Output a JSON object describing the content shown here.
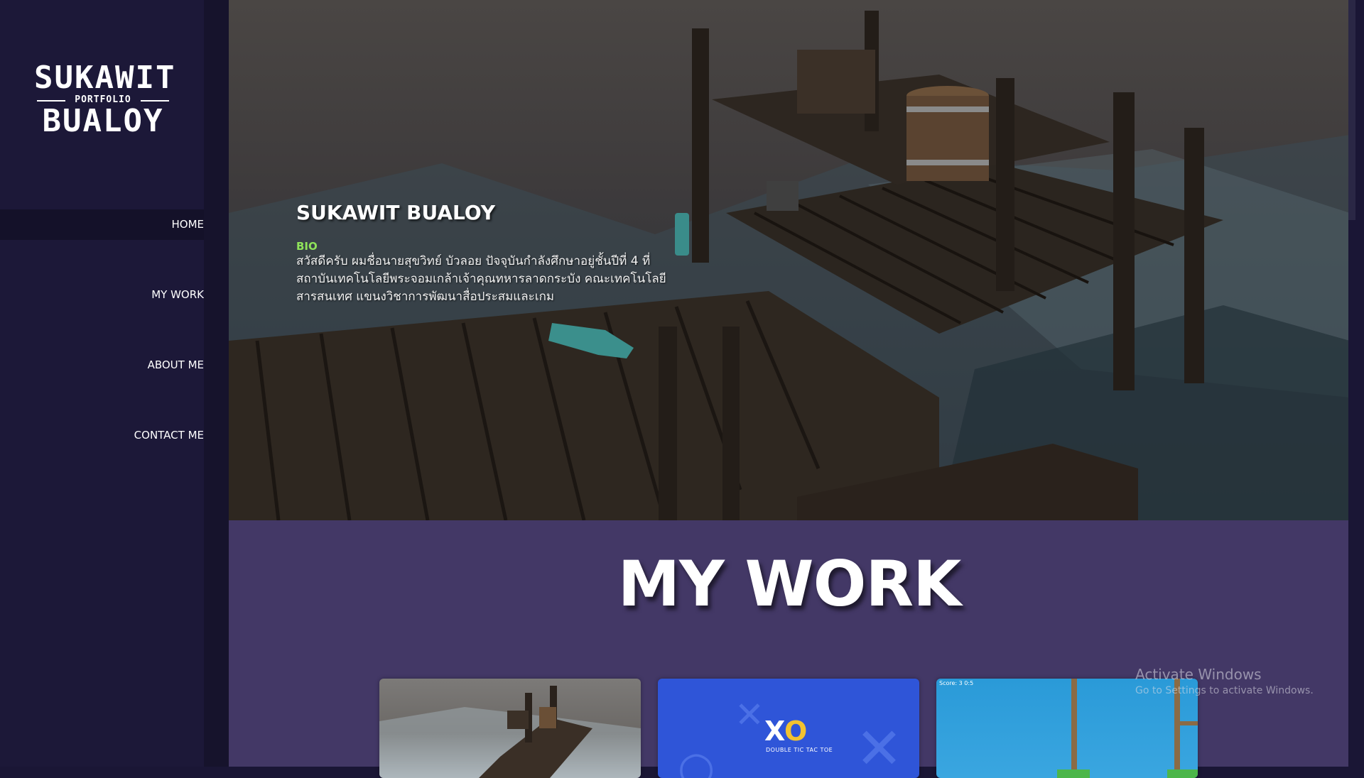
{
  "sidebar": {
    "logo": {
      "top": "SUKAWIT",
      "middle": "PORTFOLIO",
      "bottom": "BUALOY"
    },
    "nav": [
      {
        "label": "HOME",
        "active": true
      },
      {
        "label": "MY WORK",
        "active": false
      },
      {
        "label": "ABOUT ME",
        "active": false
      },
      {
        "label": "CONTACT ME",
        "active": false
      }
    ]
  },
  "hero": {
    "title": "SUKAWIT BUALOY",
    "bio_label": "BIO",
    "bio_lines": [
      "สวัสดีครับ ผมชื่อนายสุขวิทย์ บัวลอย ปัจจุบันกำลังศึกษาอยู่ชั้นปีที่ 4 ที่",
      "สถาบันเทคโนโลยีพระจอมเกล้าเจ้าคุณทหารลาดกระบัง คณะเทคโนโลยี",
      "สารสนเทศ แขนงวิชาการพัฒนาสื่อประสมและเกม"
    ]
  },
  "work": {
    "title": "MY WORK",
    "cards": [
      {
        "name": "pier-scene"
      },
      {
        "name": "xo-game",
        "logo_x": "X",
        "logo_o": "O",
        "subtitle": "DOUBLE TIC TAC TOE"
      },
      {
        "name": "platformer-game",
        "hud": "Score: 3  0:5"
      }
    ]
  },
  "watermark": {
    "title": "Activate Windows",
    "subtitle": "Go to Settings to activate Windows."
  },
  "colors": {
    "sidebar_bg": "#1c1838",
    "work_bg": "#433866",
    "bio_label": "#8fe35a",
    "xo_card": "#2f55d8"
  }
}
